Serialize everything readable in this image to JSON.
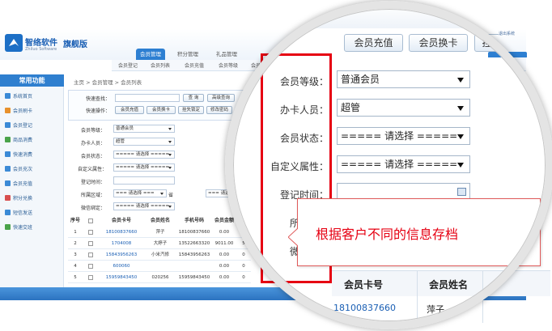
{
  "brand": {
    "name": "智络软件",
    "sub": "Zhiluo Software",
    "edition": "旗舰版"
  },
  "top_tabs": [
    "会员管理",
    "积分管理",
    "礼品管理"
  ],
  "sub_nav": [
    "会员登记",
    "会员列表",
    "会员充值",
    "会员等级",
    "会员卡"
  ],
  "sidebar": {
    "title": "常用功能",
    "items": [
      "系统首页",
      "会员刷卡",
      "会员登记",
      "商品消费",
      "快速消费",
      "会员充次",
      "会员充值",
      "积分兑换",
      "短信发送",
      "快速交班"
    ]
  },
  "breadcrumb": "主页 > 会员管理 > 会员列表",
  "quick": {
    "search_label": "快速查找：",
    "search_btn": "查 询",
    "adv_btn": "高级查询",
    "ops_label": "快速操作：",
    "ops": [
      "会员充值",
      "会员换卡",
      "挂失锁定",
      "修改密码"
    ]
  },
  "filters": [
    {
      "label": "会员等级：",
      "value": "普通会员"
    },
    {
      "label": "办卡人员：",
      "value": "超管"
    },
    {
      "label": "会员状态：",
      "value": "===== 请选择 ====="
    },
    {
      "label": "自定义属性：",
      "value": "===== 请选择 ====="
    },
    {
      "label": "登记时间：",
      "value": ""
    },
    {
      "label": "所属区域：",
      "value": "=== 请选择 ===",
      "value2": "省",
      "value3": "=== 请选择"
    },
    {
      "label": "微信绑定：",
      "value": "===== 请选择 ====="
    }
  ],
  "side_labels": [
    "生",
    "发",
    "卡"
  ],
  "table": {
    "headers": [
      "序号",
      "",
      "会员卡号",
      "会员姓名",
      "手机号码",
      "会员金额",
      "积"
    ],
    "rows": [
      [
        "1",
        "",
        "18100837660",
        "萍子",
        "18100837660",
        "0.00",
        "0"
      ],
      [
        "2",
        "",
        "1704008",
        "大婷子",
        "13522663320",
        "9011.00",
        "5"
      ],
      [
        "3",
        "",
        "15843956263",
        "小米汽修",
        "15843956263",
        "0.00",
        "0"
      ],
      [
        "4",
        "",
        "600060",
        "",
        "",
        "0.00",
        "0"
      ],
      [
        "5",
        "",
        "15959843450",
        "020256",
        "15959843450",
        "0.00",
        "0"
      ]
    ]
  },
  "top_right": "退出系统",
  "zoom": {
    "ops_label": "速操作：",
    "ops": [
      "会员充值",
      "会员换卡",
      "挂"
    ],
    "labels": [
      "会员等级：",
      "办卡人员：",
      "会员状态：",
      "自定义属性：",
      "登记时间：",
      "所属",
      "微信"
    ],
    "values": [
      "普通会员",
      "超管",
      "===== 请选择 =====",
      "===== 请选择 ====="
    ],
    "callout": "根据客户不同的信息存档",
    "col_headers": [
      "会员卡号",
      "会员姓名"
    ],
    "first_card": "18100837660",
    "first_name": "萍子",
    "tab": "管理",
    "top_right": "退出系统"
  },
  "colors": {
    "accent": "#2f7fcf",
    "highlight": "#e60012",
    "brand": "#1a5fb4"
  }
}
